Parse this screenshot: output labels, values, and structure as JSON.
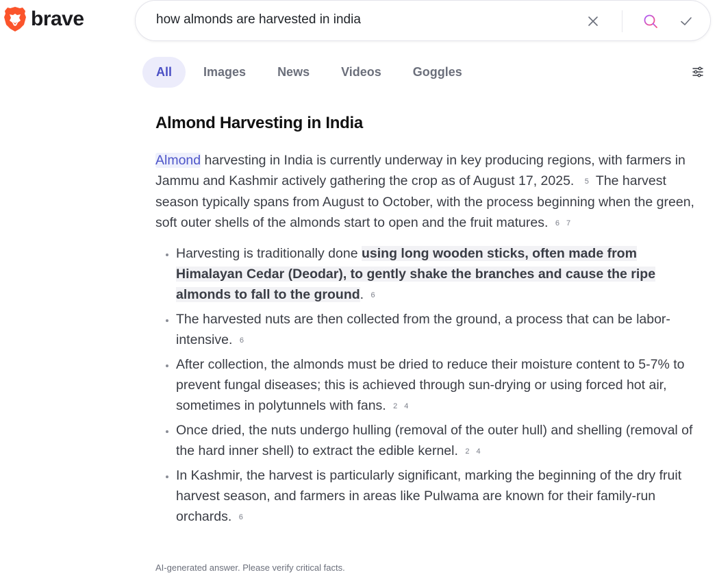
{
  "brand": {
    "name": "brave",
    "logo_icon": "brave-lion-icon",
    "accent": "#fb542b"
  },
  "search": {
    "query": "how almonds are harvested in india",
    "clear_icon": "close-icon",
    "submit_icon": "search-icon",
    "confirm_icon": "check-icon"
  },
  "tabs": [
    {
      "label": "All",
      "active": true
    },
    {
      "label": "Images",
      "active": false
    },
    {
      "label": "News",
      "active": false
    },
    {
      "label": "Videos",
      "active": false
    },
    {
      "label": "Goggles",
      "active": false
    }
  ],
  "filters_icon": "sliders-icon",
  "answer": {
    "title": "Almond Harvesting in India",
    "intro": {
      "entity": "Almond",
      "text1": " harvesting in India is currently underway in key producing regions, with farmers in Jammu and Kashmir actively gathering the crop as of August 17, 2025.",
      "cite1": "5",
      "text2": "The harvest season typically spans from August to October, with the process beginning when the green, soft outer shells of the almonds start to open and the fruit matures.",
      "cite2a": "6",
      "cite2b": "7"
    },
    "bullets": [
      {
        "pre": "Harvesting is traditionally done ",
        "highlight": "using long wooden sticks, often made from Himalayan Cedar (Deodar), to gently shake the branches and cause the ripe almonds to fall to the ground",
        "post": ".",
        "cites": [
          "6"
        ]
      },
      {
        "pre": "The harvested nuts are then collected from the ground, a process that can be labor-intensive.",
        "highlight": "",
        "post": "",
        "cites": [
          "6"
        ]
      },
      {
        "pre": "After collection, the almonds must be dried to reduce their moisture content to 5-7% to prevent fungal diseases; this is achieved through sun-drying or using forced hot air, sometimes in polytunnels with fans.",
        "highlight": "",
        "post": "",
        "cites": [
          "2",
          "4"
        ]
      },
      {
        "pre": "Once dried, the nuts undergo hulling (removal of the outer hull) and shelling (removal of the hard inner shell) to extract the edible kernel.",
        "highlight": "",
        "post": "",
        "cites": [
          "2",
          "4"
        ]
      },
      {
        "pre": "In Kashmir, the harvest is particularly significant, marking the beginning of the dry fruit harvest season, and farmers in areas like Pulwama are known for their family-run orchards.",
        "highlight": "",
        "post": "",
        "cites": [
          "6"
        ]
      }
    ],
    "disclaimer": "AI-generated answer. Please verify critical facts."
  }
}
